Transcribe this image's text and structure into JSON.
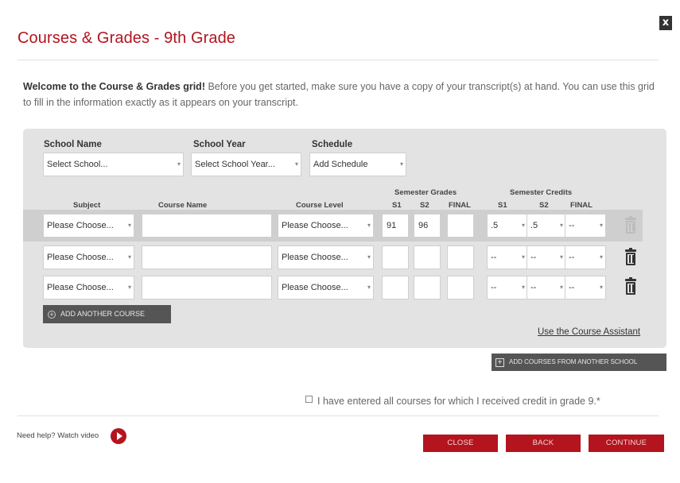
{
  "dialog": {
    "title": "Courses & Grades - 9th Grade",
    "close_glyph": "x",
    "intro_bold": "Welcome to the Course & Grades grid!",
    "intro_text": " Before you get started, make sure you have a copy of your transcript(s) at hand. You can use this grid to fill in the information exactly as it appears on your transcript."
  },
  "school": {
    "name_label": "School Name",
    "name_value": "Select School...",
    "year_label": "School Year",
    "year_value": "Select School Year...",
    "schedule_label": "Schedule",
    "schedule_value": "Add Schedule"
  },
  "grid_headers": {
    "subject": "Subject",
    "course_name": "Course Name",
    "course_level": "Course Level",
    "semester_grades": "Semester Grades",
    "semester_credits": "Semester Credits",
    "s1": "S1",
    "s2": "S2",
    "final": "FINAL"
  },
  "courses": [
    {
      "subject": "Please Choose...",
      "course_name": "",
      "level": "Please Choose...",
      "grade_s1": "91",
      "grade_s2": "96",
      "grade_final": "",
      "credit_s1": ".5",
      "credit_s2": ".5",
      "credit_final": "--"
    },
    {
      "subject": "Please Choose...",
      "course_name": "",
      "level": "Please Choose...",
      "grade_s1": "",
      "grade_s2": "",
      "grade_final": "",
      "credit_s1": "--",
      "credit_s2": "--",
      "credit_final": "--"
    },
    {
      "subject": "Please Choose...",
      "course_name": "",
      "level": "Please Choose...",
      "grade_s1": "",
      "grade_s2": "",
      "grade_final": "",
      "credit_s1": "--",
      "credit_s2": "--",
      "credit_final": "--"
    }
  ],
  "actions": {
    "add_course": "ADD ANOTHER COURSE",
    "course_assistant": "Use the Course Assistant",
    "add_school": "ADD COURSES FROM ANOTHER SCHOOL",
    "confirm_text": "I have entered all courses for which I received credit in grade 9.*",
    "help_text": "Need help? Watch video",
    "close": "CLOSE",
    "back": "BACK",
    "continue": "CONTINUE"
  },
  "icons": {
    "close": "close-icon",
    "trash": "trash-icon",
    "add": "plus-circle-icon",
    "add_school": "plus-square-icon",
    "video": "play-icon",
    "dropdown": "chevron-down-icon"
  },
  "colors": {
    "brand_red": "#b3141e",
    "panel_gray": "#e3e3e3",
    "dark_button": "#555555"
  }
}
